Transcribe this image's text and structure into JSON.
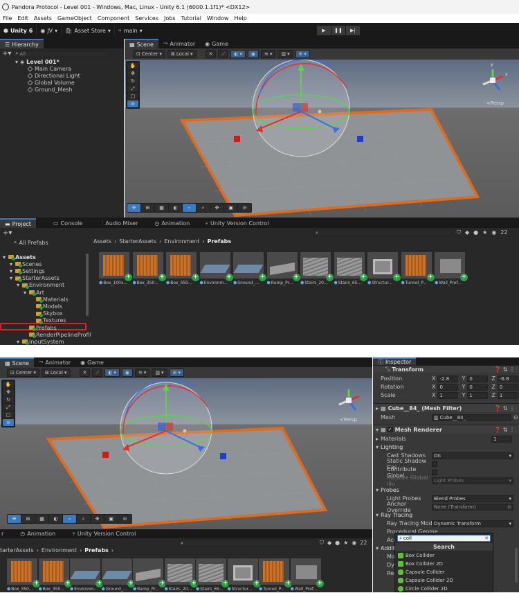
{
  "window": {
    "title": "Pandora Protocol - Level 001 - Windows, Mac, Linux - Unity 6.1 (6000.1.1f1)* <DX12>"
  },
  "menu": [
    "File",
    "Edit",
    "Assets",
    "GameObject",
    "Component",
    "Services",
    "Jobs",
    "Tutorial",
    "Window",
    "Help"
  ],
  "toolbar": {
    "unity": "Unity 6",
    "account": "JV",
    "asset_store": "Asset Store",
    "branch": "main"
  },
  "hierarchy": {
    "tab": "Hierarchy",
    "search_placeholder": "All",
    "scene": "Level 001*",
    "items": [
      "Main Camera",
      "Directional Light",
      "Global Volume",
      "Ground_Mesh"
    ]
  },
  "scene_tabs": [
    "Scene",
    "Animator",
    "Game"
  ],
  "scene_toolbar": {
    "pivot": "Center",
    "space": "Local",
    "persp": "<Persp"
  },
  "gizmo_axes": {
    "y": "y",
    "x": "x",
    "z": "z"
  },
  "bottom_tabs": [
    "Project",
    "Console",
    "Audio Mixer",
    "Animation",
    "Unity Version Control"
  ],
  "project": {
    "all_prefabs": "All Prefabs",
    "breadcrumb": [
      "Assets",
      "StarterAssets",
      "Environment",
      "Prefabs"
    ],
    "count": "22",
    "tree": [
      {
        "label": "Assets",
        "indent": 0,
        "bold": true
      },
      {
        "label": "Scenes",
        "indent": 1
      },
      {
        "label": "Settings",
        "indent": 1
      },
      {
        "label": "StarterAssets",
        "indent": 1
      },
      {
        "label": "Environment",
        "indent": 2
      },
      {
        "label": "Art",
        "indent": 3
      },
      {
        "label": "Materials",
        "indent": 4
      },
      {
        "label": "Models",
        "indent": 4
      },
      {
        "label": "Skybox",
        "indent": 4
      },
      {
        "label": "Textures",
        "indent": 4
      },
      {
        "label": "Prefabs",
        "indent": 3
      },
      {
        "label": "RenderPipelineProfil",
        "indent": 3
      },
      {
        "label": "InputSystem",
        "indent": 2
      }
    ],
    "assets": [
      "Box_100x...",
      "Box_350...",
      "Box_350...",
      "Environm...",
      "Ground_...",
      "Ramp_Pr...",
      "Stairs_20...",
      "Stairs_65...",
      "Structur...",
      "Tunnel_P...",
      "Wall_Pref..."
    ],
    "assets2": [
      "Box_350...",
      "Box_350...",
      "Environm...",
      "Ground_...",
      "Ramp_Pr...",
      "Stairs_20...",
      "Stairs_65...",
      "Structur...",
      "Tunnel_P...",
      "Wall_Pref..."
    ],
    "breadcrumb2": [
      "tarterAssets",
      "Environment",
      "Prefabs"
    ]
  },
  "bottom_tabs2": [
    "r",
    "Animation",
    "Unity Version Control"
  ],
  "inspector": {
    "tab": "Inspector",
    "transform": "Transform",
    "position": {
      "label": "Position",
      "x": "-2.8",
      "y": "0",
      "z": "-6.8"
    },
    "rotation": {
      "label": "Rotation",
      "x": "0",
      "y": "0",
      "z": "0"
    },
    "scale": {
      "label": "Scale",
      "x": "1",
      "y": "1",
      "z": "1"
    },
    "mesh_filter": "Cube__84_ (Mesh Filter)",
    "mesh_label": "Mesh",
    "mesh_value": "Cube__84_",
    "mesh_renderer": "Mesh Renderer",
    "materials_label": "Materials",
    "materials_count": "1",
    "lighting": "Lighting",
    "cast_shadows": "Cast Shadows",
    "cast_shadows_value": "On",
    "static_shadow": "Static Shadow Cas",
    "contribute_gi": "Contribute Global",
    "receive_gi": "Receive Global Illu",
    "receive_gi_value": "Light Probes",
    "probes": "Probes",
    "light_probes": "Light Probes",
    "light_probes_value": "Blend Probes",
    "anchor_override": "Anchor Override",
    "anchor_value": "None (Transform)",
    "ray_tracing": "Ray Tracing",
    "ray_tracing_mode": "Ray Tracing Mode",
    "ray_tracing_mode_value": "Dynamic Transform",
    "procedural": "Procedural Geome",
    "acc": "Acc",
    "additional": "Additi",
    "mot": "Mot",
    "dyn": "Dyn",
    "ren": "Ren"
  },
  "component_search": {
    "query": "coll",
    "header": "Search",
    "items": [
      "Box Collider",
      "Box Collider 2D",
      "Capsule Collider",
      "Capsule Collider 2D",
      "Circle Collider 2D"
    ]
  }
}
